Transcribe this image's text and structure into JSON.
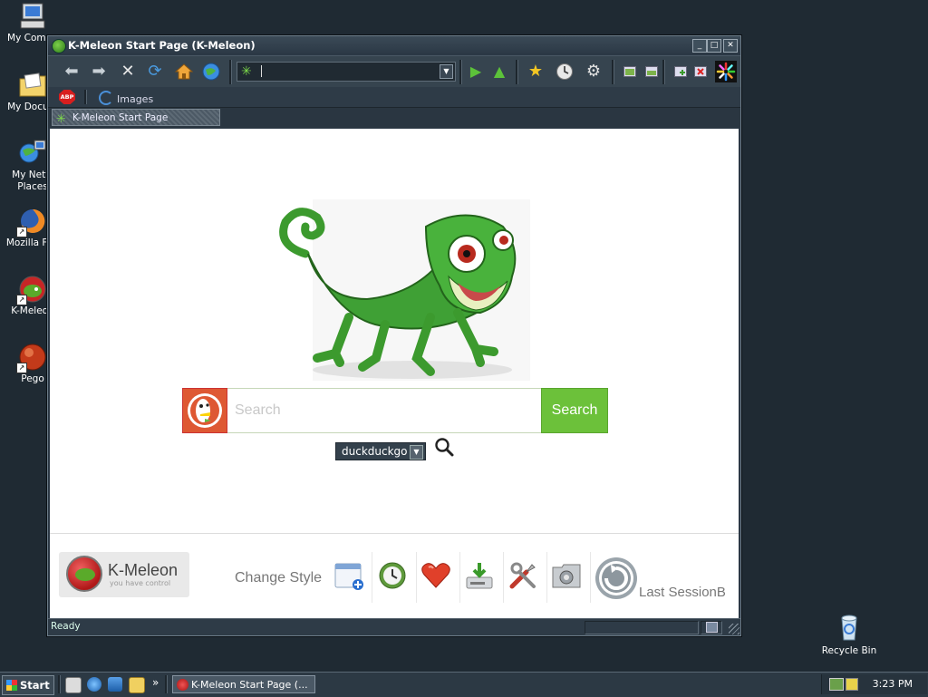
{
  "desktop": {
    "icons": [
      {
        "label_line1": "My Compu",
        "label_line2": "",
        "icon": "computer-icon"
      },
      {
        "label_line1": "My Docum",
        "label_line2": "",
        "icon": "documents-folder-icon"
      },
      {
        "label_line1": "My Netw",
        "label_line2": "Places",
        "icon": "network-places-icon"
      },
      {
        "label_line1": "Mozilla Fire",
        "label_line2": "",
        "icon": "firefox-icon"
      },
      {
        "label_line1": "K-Meleon",
        "label_line2": "",
        "icon": "kmeleon-icon"
      },
      {
        "label_line1": "Pego",
        "label_line2": "",
        "icon": "pego-icon"
      }
    ],
    "recycle_bin": "Recycle Bin"
  },
  "window": {
    "title": "K-Meleon Start Page (K-Meleon)",
    "url_value": "",
    "link_bar": {
      "abp_label": "ABP",
      "images_link": "Images"
    },
    "tab_title": "K-Meleon Start Page",
    "status_text": "Ready"
  },
  "start_page": {
    "search_placeholder": "Search",
    "search_button": "Search",
    "engine_selected": "duckduckgo",
    "brand_name": "K-Meleon",
    "brand_tagline": "you have control",
    "change_style": "Change Style",
    "last_session": "Last SessionB"
  },
  "taskbar": {
    "start_label": "Start",
    "overflow": "»",
    "active_task": "K-Meleon Start Page (...",
    "clock": "3:23 PM"
  },
  "colors": {
    "search_green": "#6cc13a",
    "ddg_orange": "#de5833",
    "chrome_dark": "#2b3845"
  }
}
